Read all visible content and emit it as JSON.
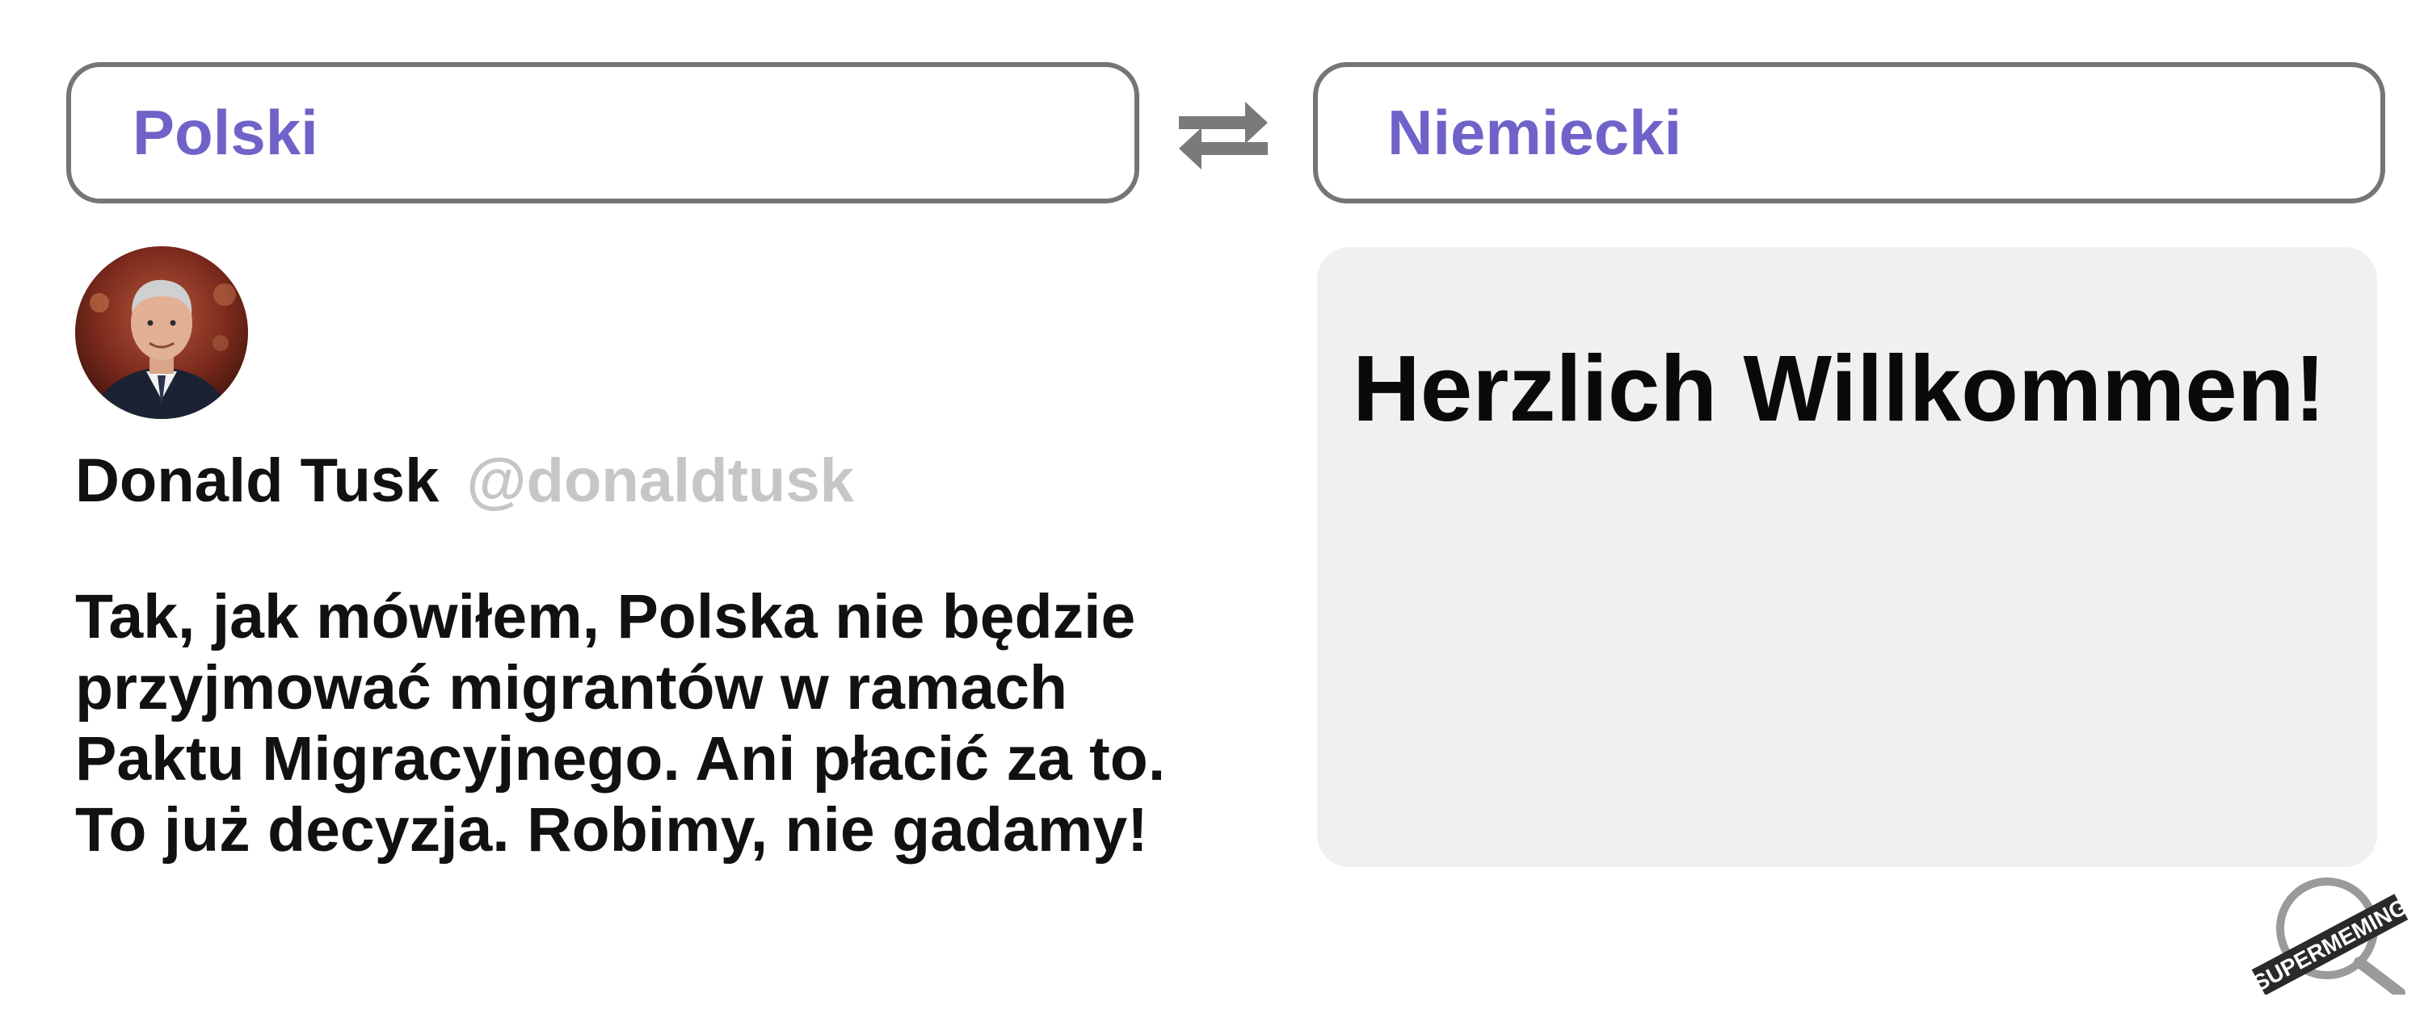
{
  "source_language": {
    "label": "Polski"
  },
  "target_language": {
    "label": "Niemiecki"
  },
  "swap_button": {
    "icon": "swap-arrows-icon"
  },
  "tweet": {
    "author_name": "Donald Tusk",
    "author_handle": "@donaldtusk",
    "lines": [
      "Tak, jak mówiłem, Polska nie będzie",
      "przyjmować migrantów w ramach",
      "Paktu Migracyjnego. Ani płacić za to.",
      "To już decyzja. Robimy, nie gadamy!"
    ]
  },
  "translation": {
    "text": "Herzlich Willkommen!"
  },
  "watermark": {
    "text": "SUPERMEMING"
  },
  "colors": {
    "accent": "#6f63c9",
    "border": "#757575",
    "handle": "#c6c6c6",
    "result_bg": "#f0f0f0"
  }
}
